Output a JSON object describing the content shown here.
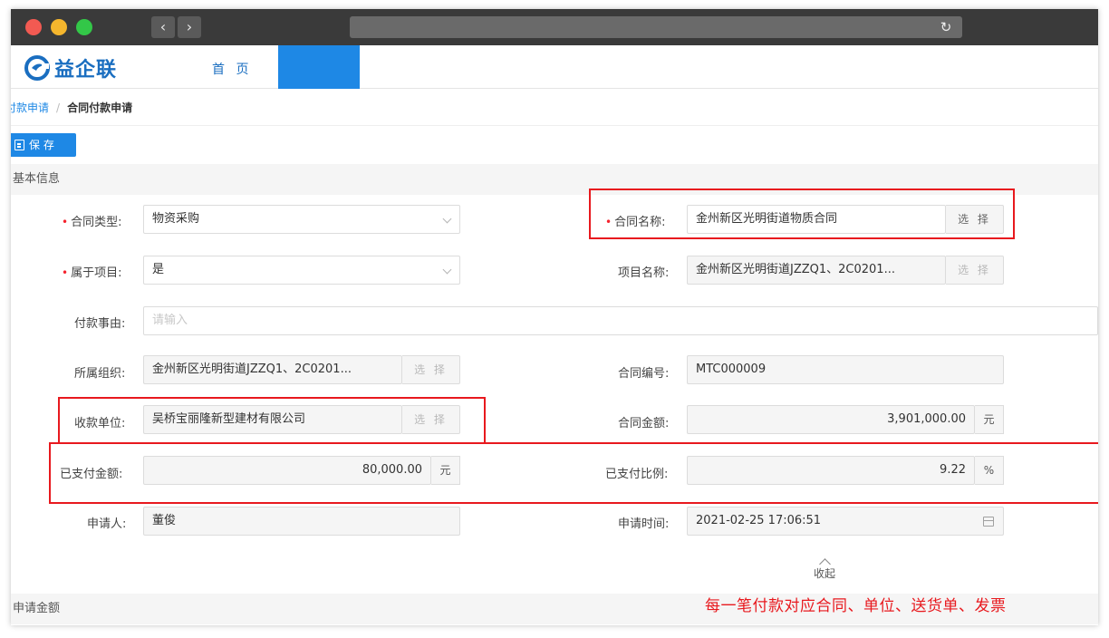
{
  "browser": {
    "back_glyph": "‹",
    "forward_glyph": "›",
    "reload_glyph": "↻"
  },
  "header": {
    "brand": "益企联",
    "nav_home": "首 页"
  },
  "breadcrumb": {
    "parent": "付款申请",
    "separator": "/",
    "current": "合同付款申请"
  },
  "toolbar": {
    "save_label": "保 存"
  },
  "sections": {
    "basic": "基本信息",
    "amount": "申请金额"
  },
  "form": {
    "contract_type": {
      "label": "合同类型:",
      "value": "物资采购"
    },
    "contract_name": {
      "label": "合同名称:",
      "value": "金州新区光明街道物质合同",
      "button": "选 择"
    },
    "belongs_project": {
      "label": "属于项目:",
      "value": "是"
    },
    "project_name": {
      "label": "项目名称:",
      "value": "金州新区光明街道JZZQ1、2C0201...",
      "button": "选 择"
    },
    "payment_reason": {
      "label": "付款事由:",
      "placeholder": "请输入"
    },
    "organization": {
      "label": "所属组织:",
      "value": "金州新区光明街道JZZQ1、2C0201...",
      "button": "选 择"
    },
    "contract_no": {
      "label": "合同编号:",
      "value": "MTC000009"
    },
    "payee": {
      "label": "收款单位:",
      "value": "吴桥宝丽隆新型建材有限公司",
      "button": "选 择"
    },
    "contract_amount": {
      "label": "合同金额:",
      "value": "3,901,000.00",
      "unit": "元"
    },
    "paid_amount": {
      "label": "已支付金额:",
      "value": "80,000.00",
      "unit": "元"
    },
    "paid_ratio": {
      "label": "已支付比例:",
      "value": "9.22",
      "unit": "%"
    },
    "applicant": {
      "label": "申请人:",
      "value": "董俊"
    },
    "apply_time": {
      "label": "申请时间:",
      "value": "2021-02-25 17:06:51"
    }
  },
  "collapse_label": "收起",
  "annotation_note": "每一笔付款对应合同、单位、送货单、发票",
  "colors": {
    "brand": "#1a6ec0",
    "primary": "#1e88e5",
    "annotation": "#e8191e"
  }
}
